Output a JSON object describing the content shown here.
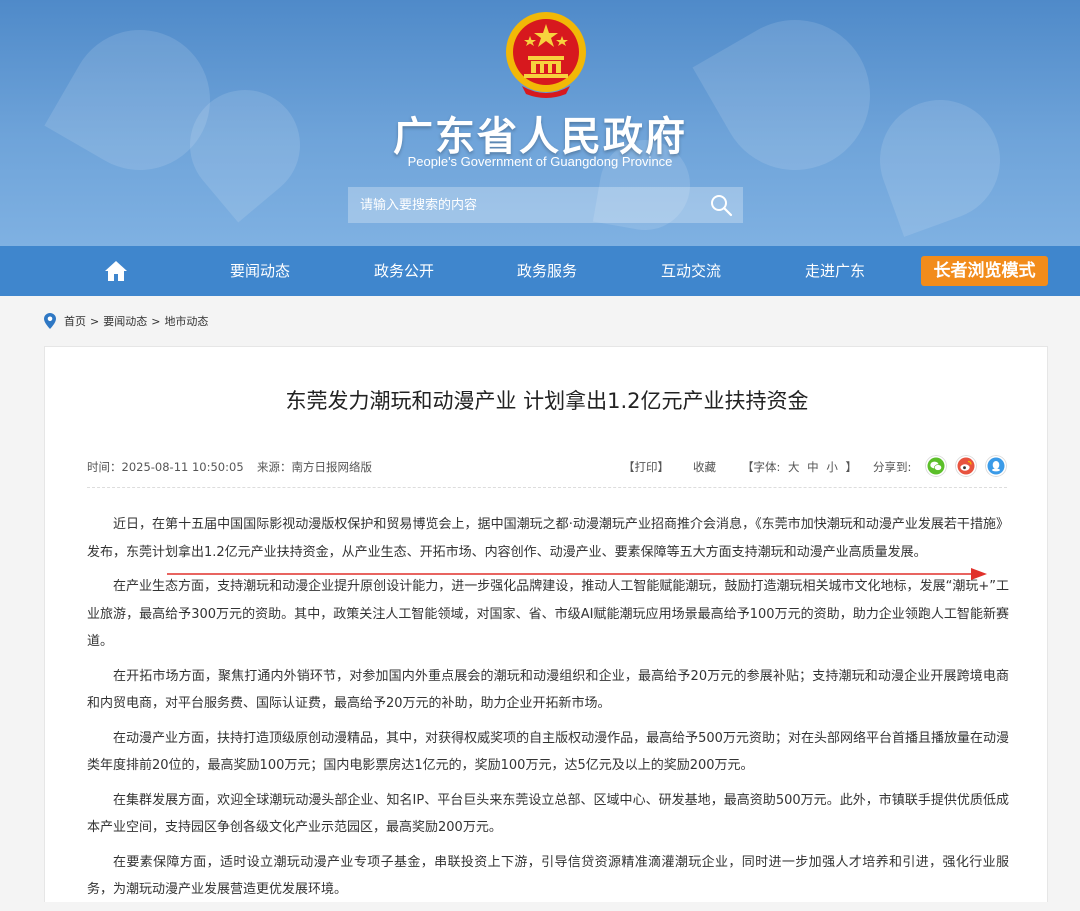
{
  "header": {
    "title": "广东省人民政府",
    "subtitle": "People's Government of Guangdong Province",
    "emblem_icon": "national-emblem",
    "search_placeholder": "请输入要搜索的内容",
    "search_icon": "search-icon"
  },
  "nav": {
    "home_icon": "home-icon",
    "items": [
      "要闻动态",
      "政务公开",
      "政务服务",
      "互动交流",
      "走进广东"
    ],
    "elder_mode": "长者浏览模式"
  },
  "breadcrumb": {
    "icon": "location-pin-icon",
    "items": [
      "首页",
      "要闻动态",
      "地市动态"
    ],
    "separator": ">"
  },
  "article": {
    "title": "东莞发力潮玩和动漫产业 计划拿出1.2亿元产业扶持资金",
    "time": "时间：2025-08-11 10:50:05",
    "source": "来源：南方日报网络版",
    "print": "【打印】",
    "favorite": "收藏",
    "font": "【字体: 大  中  小 】",
    "share_label": "分享到:",
    "share_icons": [
      "wechat-icon",
      "weibo-icon",
      "qq-icon"
    ],
    "paragraphs": [
      "近日，在第十五届中国国际影视动漫版权保护和贸易博览会上，据中国潮玩之都·动漫潮玩产业招商推介会消息，《东莞市加快潮玩和动漫产业发展若干措施》发布，东莞计划拿出1.2亿元产业扶持资金，从产业生态、开拓市场、内容创作、动漫产业、要素保障等五大方面支持潮玩和动漫产业高质量发展。",
      "在产业生态方面，支持潮玩和动漫企业提升原创设计能力，进一步强化品牌建设，推动人工智能赋能潮玩，鼓励打造潮玩相关城市文化地标，发展“潮玩+”工业旅游，最高给予300万元的资助。其中，政策关注人工智能领域，对国家、省、市级AI赋能潮玩应用场景最高给予100万元的资助，助力企业领跑人工智能新赛道。",
      "在开拓市场方面，聚焦打通内外销环节，对参加国内外重点展会的潮玩和动漫组织和企业，最高给予20万元的参展补贴；支持潮玩和动漫企业开展跨境电商和内贸电商，对平台服务费、国际认证费，最高给予20万元的补助，助力企业开拓新市场。",
      "在动漫产业方面，扶持打造顶级原创动漫精品，其中，对获得权威奖项的自主版权动漫作品，最高给予500万元资助；对在头部网络平台首播且播放量在动漫类年度排前20位的，最高奖励100万元；国内电影票房达1亿元的，奖励100万元，达5亿元及以上的奖励200万元。",
      "在集群发展方面，欢迎全球潮玩动漫头部企业、知名IP、平台巨头来东莞设立总部、区域中心、研发基地，最高资助500万元。此外，市镇联手提供优质低成本产业空间，支持园区争创各级文化产业示范园区，最高奖励200万元。",
      "在要素保障方面，适时设立潮玩动漫产业专项子基金，串联投资上下游，引导信贷资源精准滴灌潮玩企业，同时进一步加强人才培养和引进，强化行业服务，为潮玩动漫产业发展营造更优发展环境。"
    ]
  },
  "colors": {
    "header_top": "#4f8ac9",
    "nav_bg": "#3f86cd",
    "elder_bg": "#f28c1b",
    "annotation_arrow": "#e0312b"
  }
}
